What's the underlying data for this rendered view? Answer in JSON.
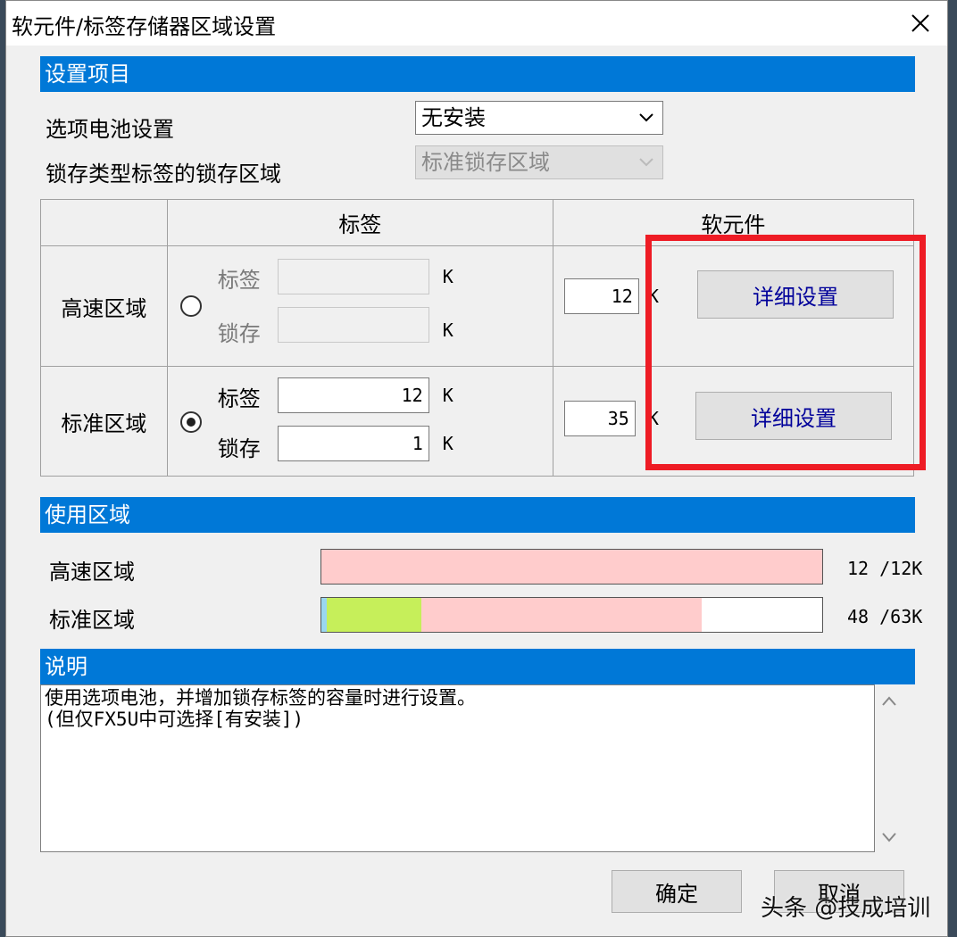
{
  "window": {
    "title": "软元件/标签存储器区域设置",
    "close_glyph": "✕"
  },
  "settings": {
    "header": "设置项目",
    "battery_label": "选项电池设置",
    "battery_value": "无安装",
    "latch_label": "锁存类型标签的锁存区域",
    "latch_value": "标准锁存区域"
  },
  "table": {
    "col_label": "标签",
    "col_device": "软元件",
    "high_speed": {
      "name": "高速区域",
      "selected": false,
      "label_caption": "标签",
      "label_value": "",
      "latch_caption": "锁存",
      "latch_value": "",
      "unit": "K",
      "device_value": "12",
      "device_unit": "K",
      "detail_button": "详细设置"
    },
    "standard": {
      "name": "标准区域",
      "selected": true,
      "label_caption": "标签",
      "label_value": "12",
      "latch_caption": "锁存",
      "latch_value": "1",
      "unit": "K",
      "device_value": "35",
      "device_unit": "K",
      "detail_button": "详细设置"
    }
  },
  "usage": {
    "header": "使用区域",
    "high_speed": {
      "label": "高速区域",
      "text": "12 /12K",
      "used_fraction": 1.0
    },
    "standard": {
      "label": "标准区域",
      "text": "48 /63K",
      "device_fraction": 0.01,
      "label_fraction": 0.19,
      "latch_fraction": 0.56
    },
    "colors": {
      "label": "#ffcccc",
      "device": "#c6ef5a",
      "latch": "#9ad7f0"
    }
  },
  "description": {
    "header": "说明",
    "line1": "使用选项电池，并增加锁存标签的容量时进行设置。",
    "line2": "(但仅FX5U中可选择[有安装])"
  },
  "buttons": {
    "ok": "确定",
    "cancel": "取消"
  },
  "watermark": "头条 @技成培训",
  "accent_color": "#0078d7",
  "highlight_color": "#ee1c25"
}
